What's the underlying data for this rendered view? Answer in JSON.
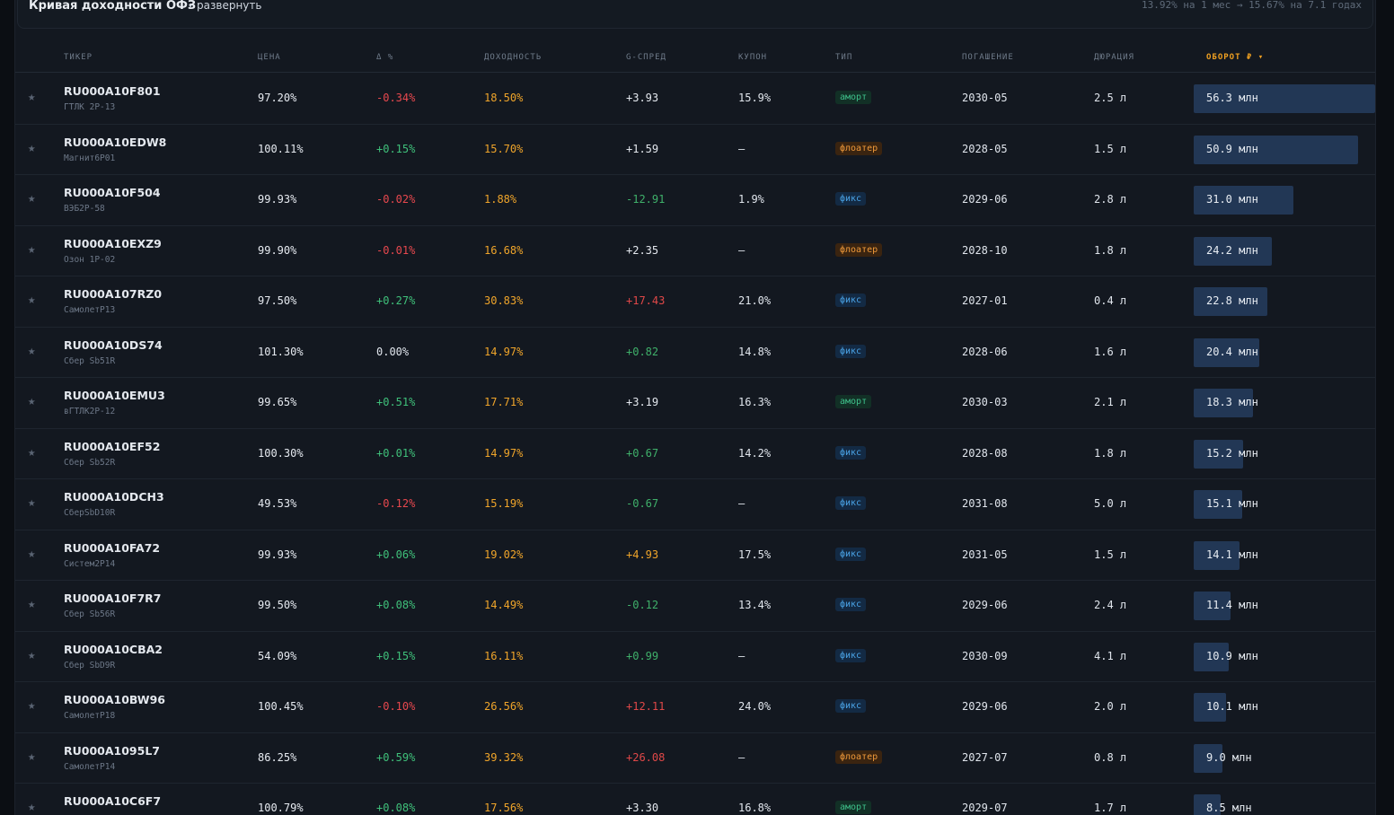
{
  "curve": {
    "title": "Кривая доходности ОФЗ",
    "toggle_label": "развернуть",
    "summary": "13.92% на 1 мес → 15.67% на 7.1 годах"
  },
  "table": {
    "headers": {
      "ticker": "ТИКЕР",
      "price": "ЦЕНА",
      "change": "Δ %",
      "yield": "ДОХОДНОСТЬ",
      "gspread": "G-СПРЕД",
      "coupon": "КУПОН",
      "type": "ТИП",
      "maturity": "ПОГАШЕНИЕ",
      "duration": "ДЮРАЦИЯ",
      "turnover": "ОБОРОТ ₽ ▾"
    },
    "star_glyph": "★",
    "rows": [
      {
        "ticker": "RU000A10F801",
        "issuer": "ГТЛК 2Р-13",
        "price": "97.20%",
        "change": "-0.34%",
        "chg_sign": "neg",
        "yield": "18.50%",
        "gspread": "+3.93",
        "gs_tone": "sneu",
        "coupon": "15.9%",
        "type": "аморт",
        "type_kind": "t-amort",
        "maturity": "2030-05",
        "duration": "2.5 л",
        "turnover": "56.3 млн",
        "turnover_mln": 56.3
      },
      {
        "ticker": "RU000A10EDW8",
        "issuer": "Магнит6Р01",
        "price": "100.11%",
        "change": "+0.15%",
        "chg_sign": "pos",
        "yield": "15.70%",
        "gspread": "+1.59",
        "gs_tone": "sneu",
        "coupon": "—",
        "type": "флоатер",
        "type_kind": "t-float",
        "maturity": "2028-05",
        "duration": "1.5 л",
        "turnover": "50.9 млн",
        "turnover_mln": 50.9
      },
      {
        "ticker": "RU000A10F504",
        "issuer": "ВЭБ2Р-58",
        "price": "99.93%",
        "change": "-0.02%",
        "chg_sign": "neg",
        "yield": "1.88%",
        "gspread": "-12.91",
        "gs_tone": "spos",
        "coupon": "1.9%",
        "type": "фикс",
        "type_kind": "t-fix",
        "maturity": "2029-06",
        "duration": "2.8 л",
        "turnover": "31.0 млн",
        "turnover_mln": 31.0
      },
      {
        "ticker": "RU000A10EXZ9",
        "issuer": "Озон 1Р-02",
        "price": "99.90%",
        "change": "-0.01%",
        "chg_sign": "neg",
        "yield": "16.68%",
        "gspread": "+2.35",
        "gs_tone": "sneu",
        "coupon": "—",
        "type": "флоатер",
        "type_kind": "t-float",
        "maturity": "2028-10",
        "duration": "1.8 л",
        "turnover": "24.2 млн",
        "turnover_mln": 24.2
      },
      {
        "ticker": "RU000A107RZ0",
        "issuer": "СамолетР13",
        "price": "97.50%",
        "change": "+0.27%",
        "chg_sign": "pos",
        "yield": "30.83%",
        "gspread": "+17.43",
        "gs_tone": "sneg",
        "coupon": "21.0%",
        "type": "фикс",
        "type_kind": "t-fix",
        "maturity": "2027-01",
        "duration": "0.4 л",
        "turnover": "22.8 млн",
        "turnover_mln": 22.8
      },
      {
        "ticker": "RU000A10DS74",
        "issuer": "Сбер Sb51R",
        "price": "101.30%",
        "change": "0.00%",
        "chg_sign": "zero",
        "yield": "14.97%",
        "gspread": "+0.82",
        "gs_tone": "spos",
        "coupon": "14.8%",
        "type": "фикс",
        "type_kind": "t-fix",
        "maturity": "2028-06",
        "duration": "1.6 л",
        "turnover": "20.4 млн",
        "turnover_mln": 20.4
      },
      {
        "ticker": "RU000A10EMU3",
        "issuer": "вГТЛК2Р-12",
        "price": "99.65%",
        "change": "+0.51%",
        "chg_sign": "pos",
        "yield": "17.71%",
        "gspread": "+3.19",
        "gs_tone": "sneu",
        "coupon": "16.3%",
        "type": "аморт",
        "type_kind": "t-amort",
        "maturity": "2030-03",
        "duration": "2.1 л",
        "turnover": "18.3 млн",
        "turnover_mln": 18.3
      },
      {
        "ticker": "RU000A10EF52",
        "issuer": "Сбер Sb52R",
        "price": "100.30%",
        "change": "+0.01%",
        "chg_sign": "pos",
        "yield": "14.97%",
        "gspread": "+0.67",
        "gs_tone": "spos",
        "coupon": "14.2%",
        "type": "фикс",
        "type_kind": "t-fix",
        "maturity": "2028-08",
        "duration": "1.8 л",
        "turnover": "15.2 млн",
        "turnover_mln": 15.2
      },
      {
        "ticker": "RU000A10DCH3",
        "issuer": "СберSbD10R",
        "price": "49.53%",
        "change": "-0.12%",
        "chg_sign": "neg",
        "yield": "15.19%",
        "gspread": "-0.67",
        "gs_tone": "spos",
        "coupon": "—",
        "type": "фикс",
        "type_kind": "t-fix",
        "maturity": "2031-08",
        "duration": "5.0 л",
        "turnover": "15.1 млн",
        "turnover_mln": 15.1
      },
      {
        "ticker": "RU000A10FA72",
        "issuer": "Систем2Р14",
        "price": "99.93%",
        "change": "+0.06%",
        "chg_sign": "pos",
        "yield": "19.02%",
        "gspread": "+4.93",
        "gs_tone": "sorange",
        "coupon": "17.5%",
        "type": "фикс",
        "type_kind": "t-fix",
        "maturity": "2031-05",
        "duration": "1.5 л",
        "turnover": "14.1 млн",
        "turnover_mln": 14.1
      },
      {
        "ticker": "RU000A10F7R7",
        "issuer": "Сбер Sb56R",
        "price": "99.50%",
        "change": "+0.08%",
        "chg_sign": "pos",
        "yield": "14.49%",
        "gspread": "-0.12",
        "gs_tone": "spos",
        "coupon": "13.4%",
        "type": "фикс",
        "type_kind": "t-fix",
        "maturity": "2029-06",
        "duration": "2.4 л",
        "turnover": "11.4 млн",
        "turnover_mln": 11.4
      },
      {
        "ticker": "RU000A10CBA2",
        "issuer": "Сбер SbD9R",
        "price": "54.09%",
        "change": "+0.15%",
        "chg_sign": "pos",
        "yield": "16.11%",
        "gspread": "+0.99",
        "gs_tone": "spos",
        "coupon": "—",
        "type": "фикс",
        "type_kind": "t-fix",
        "maturity": "2030-09",
        "duration": "4.1 л",
        "turnover": "10.9 млн",
        "turnover_mln": 10.9
      },
      {
        "ticker": "RU000A10BW96",
        "issuer": "СамолетР18",
        "price": "100.45%",
        "change": "-0.10%",
        "chg_sign": "neg",
        "yield": "26.56%",
        "gspread": "+12.11",
        "gs_tone": "sneg",
        "coupon": "24.0%",
        "type": "фикс",
        "type_kind": "t-fix",
        "maturity": "2029-06",
        "duration": "2.0 л",
        "turnover": "10.1 млн",
        "turnover_mln": 10.1
      },
      {
        "ticker": "RU000A1095L7",
        "issuer": "СамолетР14",
        "price": "86.25%",
        "change": "+0.59%",
        "chg_sign": "pos",
        "yield": "39.32%",
        "gspread": "+26.08",
        "gs_tone": "sneg",
        "coupon": "—",
        "type": "флоатер",
        "type_kind": "t-float",
        "maturity": "2027-07",
        "duration": "0.8 л",
        "turnover": "9.0 млн",
        "turnover_mln": 9.0
      },
      {
        "ticker": "RU000A10C6F7",
        "issuer": "",
        "price": "100.79%",
        "change": "+0.08%",
        "chg_sign": "pos",
        "yield": "17.56%",
        "gspread": "+3.30",
        "gs_tone": "sneu",
        "coupon": "16.8%",
        "type": "аморт",
        "type_kind": "t-amort",
        "maturity": "2029-07",
        "duration": "1.7 л",
        "turnover": "8.5 млн",
        "turnover_mln": 8.5
      }
    ]
  }
}
